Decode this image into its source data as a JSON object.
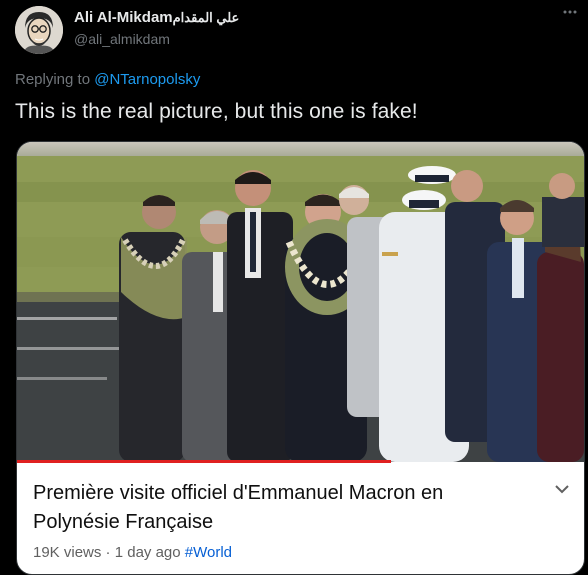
{
  "tweet": {
    "author_name": "Ali Al-Mikdam",
    "author_name_ar": "علي المقدام",
    "handle": "@ali_almikdam",
    "more_icon": "more-horizontal-icon",
    "replying_prefix": "Replying to",
    "replying_to": "@NTarnopolsky",
    "text": "This is the real picture, but this one is fake!"
  },
  "card": {
    "title_line1": "Première visite officiel d'Emmanuel Macron en",
    "title_line2": "Polynésie Française",
    "views": "19K views",
    "separator": "·",
    "age": "1 day ago",
    "hashtag": "#World",
    "progress_fraction": 0.66,
    "expand_icon": "chevron-down-icon"
  },
  "colors": {
    "background": "#000000",
    "link": "#1d9bf0",
    "hashtag": "#065fd4",
    "progress": "#e02020"
  }
}
